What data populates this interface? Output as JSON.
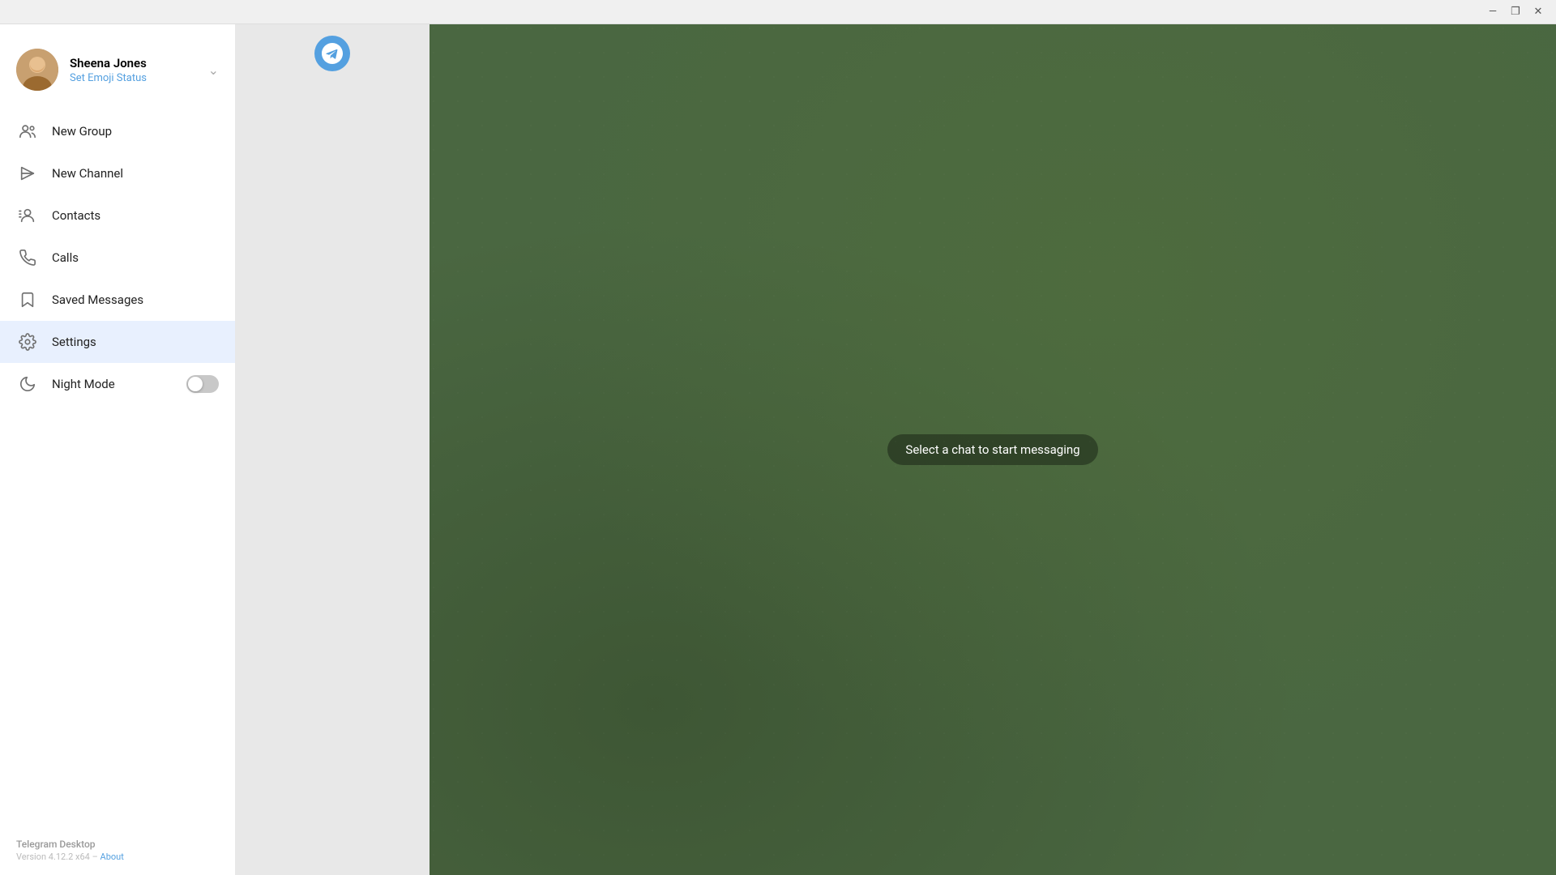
{
  "titleBar": {
    "minimizeLabel": "—",
    "maximizeLabel": "❐",
    "closeLabel": "✕"
  },
  "profile": {
    "name": "Sheena Jones",
    "statusLabel": "Set Emoji Status",
    "avatarAlt": "Sheena Jones avatar"
  },
  "menu": {
    "items": [
      {
        "id": "new-group",
        "label": "New Group",
        "icon": "group-icon"
      },
      {
        "id": "new-channel",
        "label": "New Channel",
        "icon": "channel-icon"
      },
      {
        "id": "contacts",
        "label": "Contacts",
        "icon": "contacts-icon"
      },
      {
        "id": "calls",
        "label": "Calls",
        "icon": "calls-icon"
      },
      {
        "id": "saved-messages",
        "label": "Saved Messages",
        "icon": "bookmark-icon"
      },
      {
        "id": "settings",
        "label": "Settings",
        "icon": "settings-icon",
        "active": true
      }
    ],
    "nightMode": {
      "label": "Night Mode",
      "enabled": false
    }
  },
  "footer": {
    "appName": "Telegram Desktop",
    "version": "Version 4.12.2 x64 – ",
    "aboutLabel": "About"
  },
  "chatArea": {
    "selectChatMessage": "Select a chat to start messaging"
  }
}
